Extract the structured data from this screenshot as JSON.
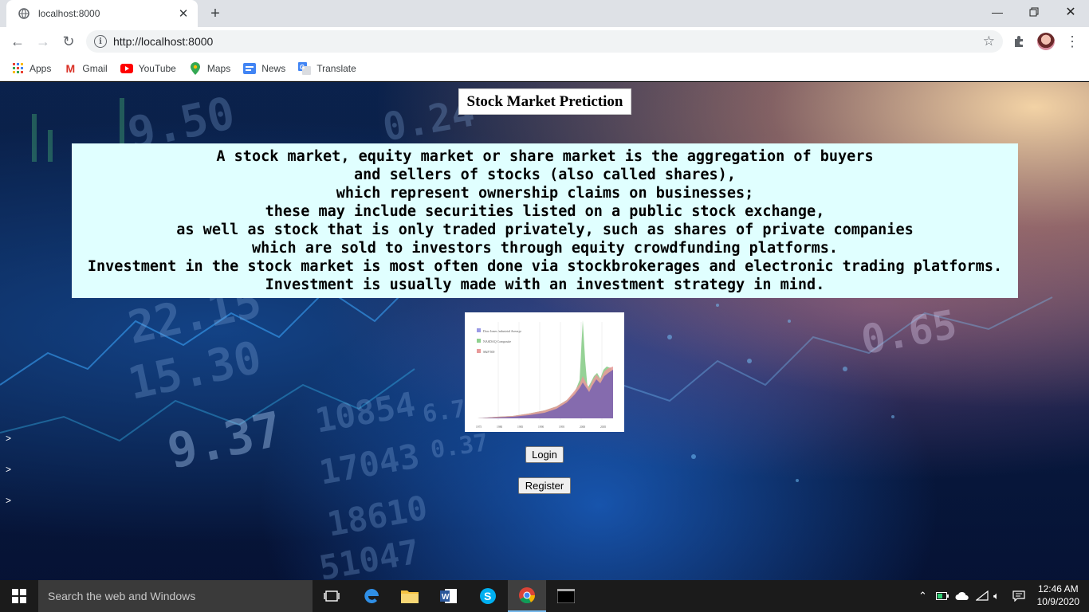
{
  "browser": {
    "tab_title": "localhost:8000",
    "url": "http://localhost:8000",
    "bookmarks": [
      {
        "label": "Apps",
        "icon": "apps-grid-icon"
      },
      {
        "label": "Gmail",
        "icon": "gmail-icon"
      },
      {
        "label": "YouTube",
        "icon": "youtube-icon"
      },
      {
        "label": "Maps",
        "icon": "maps-icon"
      },
      {
        "label": "News",
        "icon": "news-icon"
      },
      {
        "label": "Translate",
        "icon": "translate-icon"
      }
    ]
  },
  "page": {
    "title": "Stock Market Pretiction",
    "description": [
      "A stock market, equity market or share market is the aggregation of buyers",
      "and sellers of stocks (also called shares),",
      "which represent ownership claims on businesses;",
      "these may include securities listed on a public stock exchange,",
      "as well as stock that is only traded privately, such as shares of private companies",
      "which are sold to investors through equity crowdfunding platforms.",
      "Investment in the stock market is most often done via stockbrokerages and electronic trading platforms.",
      "Investment is usually made with an investment strategy in mind."
    ],
    "login_label": "Login",
    "register_label": "Register",
    "side_markers": [
      ">",
      ">",
      ">"
    ],
    "chart_image": {
      "legend": [
        "Dow Jones Industrial Average",
        "NASDAQ Composite",
        "S&P 500"
      ],
      "x_ticks": [
        "1975",
        "1980",
        "1985",
        "1990",
        "1995",
        "2000",
        "2005"
      ]
    },
    "background_numbers": [
      "9.50",
      "0.24",
      "22.15",
      "15.30",
      "9.37",
      "10854",
      "17043",
      "18610",
      "51047",
      "0.65",
      "6.70",
      "0.37"
    ]
  },
  "taskbar": {
    "search_placeholder": "Search the web and Windows",
    "time": "12:46 AM",
    "date": "10/9/2020"
  },
  "colors": {
    "description_bg": "#e0ffff",
    "tab_strip": "#dee1e6",
    "taskbar": "#1b1b1b"
  }
}
